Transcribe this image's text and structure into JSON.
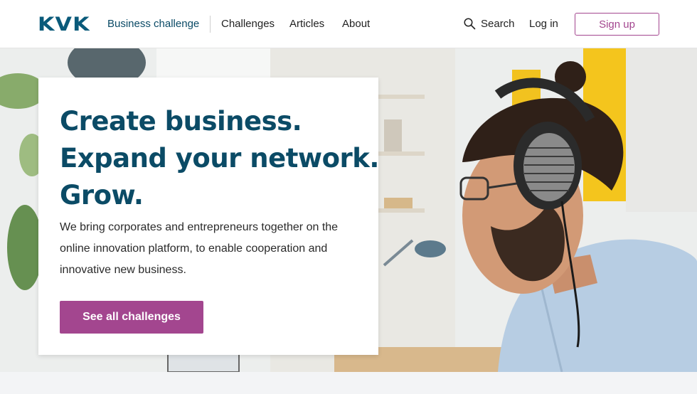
{
  "header": {
    "logo": "KVK",
    "brand_subtitle": "Business challenge",
    "nav": [
      "Challenges",
      "Articles",
      "About"
    ],
    "search_label": "Search",
    "login_label": "Log in",
    "signup_label": "Sign up"
  },
  "hero": {
    "headline_lines": [
      "Create business.",
      "Expand your network.",
      "Grow."
    ],
    "intro": "We bring corporates and entrepreneurs together on the online innovation platform, to enable cooperation and innovative new business.",
    "cta_label": "See all challenges"
  },
  "colors": {
    "brand_blue": "#0a5a7a",
    "headline_blue": "#0b4b66",
    "accent_purple": "#a3468f"
  }
}
